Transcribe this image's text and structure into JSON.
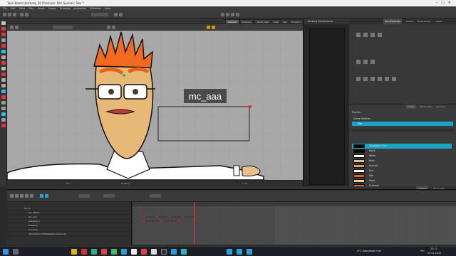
{
  "window": {
    "title": "Toon Boom Harmony 20 Premium: Doc Session: Dev *"
  },
  "menu": [
    "File",
    "Edit",
    "View",
    "Play",
    "Insert",
    "Scene",
    "Drawing",
    "Animation",
    "Windows",
    "Help"
  ],
  "view_tabs": {
    "camera": "Camera",
    "drawing": "Drawing",
    "node_view": "Node View",
    "side": "Side",
    "top": "Top",
    "function": "Function"
  },
  "canvas": {
    "label": "mc_aaa",
    "zoom": "99%",
    "status_mode": "Drawing",
    "status_coord": "Fr 13"
  },
  "drawing_substitutions": {
    "title": "Drawing Substitutions"
  },
  "right_tabs": {
    "tool_props": "Tool Properties",
    "library": "Library",
    "node_library": "Node Library",
    "layer": "Layer"
  },
  "colour_tabs": {
    "colour": "Colour",
    "node_view": "Node View",
    "camera": "Camera"
  },
  "palettes": {
    "header": "Palettes",
    "scene_palettes": "Scene Palettes",
    "item": "Doc"
  },
  "swatches": [
    {
      "name": "Vectorised Line",
      "color": "#000000",
      "selected": true
    },
    {
      "name": "Black",
      "color": "#000000"
    },
    {
      "name": "White",
      "color": "#ffffff"
    },
    {
      "name": "Body",
      "color": "#e6c48d"
    },
    {
      "name": "EyeLids",
      "color": "#d9a65f"
    },
    {
      "name": "Eye",
      "color": "#ffffff"
    },
    {
      "name": "Hair",
      "color": "#e8631a"
    },
    {
      "name": "Head",
      "color": "#f0d2a0"
    },
    {
      "name": "Eyebrow",
      "color": "#e8631a"
    }
  ],
  "timeline": {
    "tab": "Timeline",
    "node_view": "Node View"
  },
  "layers": [
    {
      "name": "Doc-X"
    },
    {
      "name": "Doc-HUD1"
    },
    {
      "name": "mc_aaa"
    },
    {
      "name": "Drawing_1"
    },
    {
      "name": "Drawing"
    },
    {
      "name": "Drawing"
    },
    {
      "name": "dam2k1DocTMANwMaNumbOverLe"
    }
  ],
  "taskbar": {
    "weather": "-6°C Ливневый снег",
    "lang": "РУС",
    "time": "23:17",
    "date": "04.02.2022"
  }
}
